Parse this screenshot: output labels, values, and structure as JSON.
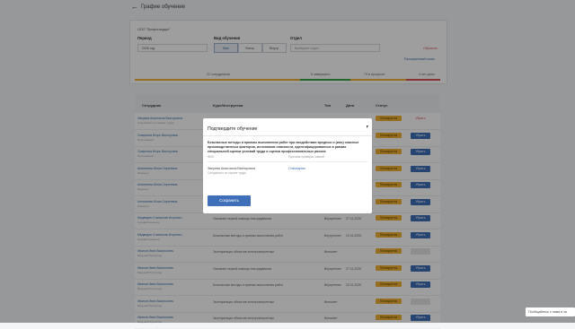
{
  "header": {
    "back_label": "Графие обучение"
  },
  "filters": {
    "org": "ООО \"Профстандарт\"",
    "period_label": "Период",
    "period_value": "2026 год",
    "type_label": "Вид обучения",
    "type_options": [
      "Все",
      "Внеш.",
      "Внутр."
    ],
    "dept_label": "Отдел",
    "dept_placeholder": "Выберите отдел",
    "reset": "Сбросить",
    "advanced": "Расширенный поиск"
  },
  "status_tabs": [
    {
      "label": "22 сотрудников",
      "color": "#f2b233"
    },
    {
      "label": "6 завершено",
      "color": "#37a447"
    },
    {
      "label": "73 в процессе",
      "color": "#f2b233"
    },
    {
      "label": "4 нет даты",
      "color": "#d9534f"
    }
  ],
  "table": {
    "columns": [
      "Сотрудник",
      "Курс/Инструктаж",
      "Тип",
      "Дата",
      "Статус"
    ],
    "rows": [
      {
        "name": "Зверева Анастасия Викторовна",
        "pos": "Специалист по охране труда",
        "course": "",
        "type": "",
        "date": "",
        "status": "Планируется",
        "action": "Убрать",
        "act_kind": "del"
      },
      {
        "name": "Смирнова Игорь Викторович",
        "pos": "Программист",
        "course": "",
        "type": "",
        "date": "",
        "status": "Планируется",
        "action": "Убрать",
        "act_kind": "btn"
      },
      {
        "name": "Смирнова Игорь Викторович",
        "pos": "Программист",
        "course": "",
        "type": "",
        "date": "",
        "status": "Планируется",
        "action": "Убрать",
        "act_kind": "btn"
      },
      {
        "name": "Алексеева Юлия Сергеевна",
        "pos": "Инженер",
        "course": "",
        "type": "",
        "date": "",
        "status": "Планируется",
        "action": "Убрать",
        "act_kind": "btn"
      },
      {
        "name": "Алексеева Юлия Сергеевна",
        "pos": "Инженер",
        "course": "",
        "type": "",
        "date": "",
        "status": "Планируется",
        "action": "Убрать",
        "act_kind": "btn"
      },
      {
        "name": "Алексеева Юлия Сергеевна",
        "pos": "Инженер",
        "course": "",
        "type": "",
        "date": "",
        "status": "Планируется",
        "action": "Убрать",
        "act_kind": "btn"
      },
      {
        "name": "Медведев Станислав Игоревич",
        "pos": "Сетевой инженер",
        "course": "Оказание первой помощи пострадавшим",
        "type": "Внутреннее",
        "date": "27.01.2026",
        "status": "Планируется",
        "action": "Убрать",
        "act_kind": "btn"
      },
      {
        "name": "Медведев Станислав Игоревич",
        "pos": "Сетевой инженер",
        "course": "Безопасные методы и приемы выполнения работ",
        "type": "Внутреннее",
        "date": "22.01.2026",
        "status": "Планируется",
        "action": "Убрать",
        "act_kind": "btn"
      },
      {
        "name": "Иванов Иван Васильевич",
        "pos": "Ведущий бухгалтер",
        "course": "Эксплуатация объектов электроэнергетики",
        "type": "Внешнее",
        "date": "",
        "status": "Планируется",
        "action": "",
        "act_kind": "off"
      },
      {
        "name": "Иванов Иван Васильевич",
        "pos": "Ведущий бухгалтер",
        "course": "Оказание первой помощи пострадавшим",
        "type": "Внутреннее",
        "date": "27.01.2026",
        "status": "Планируется",
        "action": "Убрать",
        "act_kind": "btn"
      },
      {
        "name": "Иванов Иван Васильевич",
        "pos": "Ведущий бухгалтер",
        "course": "Безопасные методы и приемы выполнения работ",
        "type": "Внутреннее",
        "date": "22.01.2026",
        "status": "Планируется",
        "action": "Убрать",
        "act_kind": "btn"
      },
      {
        "name": "Иванов Иван Васильевич",
        "pos": "Ведущий бухгалтер",
        "course": "Эксплуатация объектов электроэнергетики",
        "type": "Внешнее",
        "date": "",
        "status": "Планируется",
        "action": "",
        "act_kind": "off"
      },
      {
        "name": "Иванов Иван Васильевич",
        "pos": "Ведущий бухгалтер",
        "course": "Эксплуатация объектов электроэнергетики",
        "type": "Внешнее",
        "date": "",
        "status": "Планируется",
        "action": "Убрать",
        "act_kind": "btn"
      }
    ]
  },
  "modal": {
    "title": "Подтвердите обучение",
    "description": "Безопасные методы и приемы выполнения работ при воздействии вредных и (или) опасных производственных факторов, источников опасности, идентифицированных в рамках специальной оценки условий труда и оценки профессиональных рисков",
    "col_fio": "ФИО",
    "col_reason": "Причина проверки знаний",
    "person_name": "Зверева Анастасия Викторовна",
    "person_pos": "Специалист по охране труда",
    "reason_link": "Очередная",
    "save": "Сохранить"
  },
  "toast": "Пообщайтесь с нами в ча"
}
